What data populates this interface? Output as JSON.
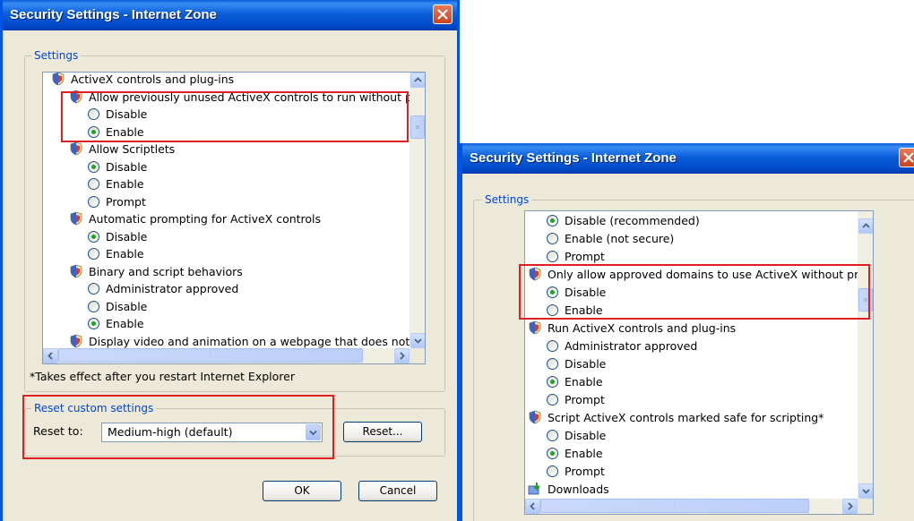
{
  "left_dialog": {
    "title": "Security Settings - Internet Zone",
    "settings_label": "Settings",
    "list": [
      {
        "kind": "header",
        "text": "ActiveX controls and plug-ins"
      },
      {
        "kind": "header",
        "text": "Allow previously unused ActiveX controls to run without prom"
      },
      {
        "kind": "option",
        "text": "Disable",
        "checked": false
      },
      {
        "kind": "option",
        "text": "Enable",
        "checked": true
      },
      {
        "kind": "header",
        "text": "Allow Scriptlets"
      },
      {
        "kind": "option",
        "text": "Disable",
        "checked": true
      },
      {
        "kind": "option",
        "text": "Enable",
        "checked": false
      },
      {
        "kind": "option",
        "text": "Prompt",
        "checked": false
      },
      {
        "kind": "header",
        "text": "Automatic prompting for ActiveX controls"
      },
      {
        "kind": "option",
        "text": "Disable",
        "checked": true
      },
      {
        "kind": "option",
        "text": "Enable",
        "checked": false
      },
      {
        "kind": "header",
        "text": "Binary and script behaviors"
      },
      {
        "kind": "option",
        "text": "Administrator approved",
        "checked": false
      },
      {
        "kind": "option",
        "text": "Disable",
        "checked": false
      },
      {
        "kind": "option",
        "text": "Enable",
        "checked": true
      },
      {
        "kind": "header",
        "text": "Display video and animation on a webpage that does not use"
      }
    ],
    "restart_note": "*Takes effect after you restart Internet Explorer",
    "reset_group_label": "Reset custom settings",
    "reset_to_label": "Reset to:",
    "reset_to_value": "Medium-high (default)",
    "reset_button": "Reset...",
    "ok_button": "OK",
    "cancel_button": "Cancel"
  },
  "right_dialog": {
    "title": "Security Settings - Internet Zone",
    "settings_label": "Settings",
    "list": [
      {
        "kind": "option",
        "text": "Disable (recommended)",
        "checked": true
      },
      {
        "kind": "option",
        "text": "Enable (not secure)",
        "checked": false
      },
      {
        "kind": "option",
        "text": "Prompt",
        "checked": false
      },
      {
        "kind": "header",
        "text": "Only allow approved domains to use ActiveX without prompt"
      },
      {
        "kind": "option",
        "text": "Disable",
        "checked": true
      },
      {
        "kind": "option",
        "text": "Enable",
        "checked": false
      },
      {
        "kind": "header",
        "text": "Run ActiveX controls and plug-ins"
      },
      {
        "kind": "option",
        "text": "Administrator approved",
        "checked": false
      },
      {
        "kind": "option",
        "text": "Disable",
        "checked": false
      },
      {
        "kind": "option",
        "text": "Enable",
        "checked": true
      },
      {
        "kind": "option",
        "text": "Prompt",
        "checked": false
      },
      {
        "kind": "header",
        "text": "Script ActiveX controls marked safe for scripting*"
      },
      {
        "kind": "option",
        "text": "Disable",
        "checked": false
      },
      {
        "kind": "option",
        "text": "Enable",
        "checked": true
      },
      {
        "kind": "option",
        "text": "Prompt",
        "checked": false
      },
      {
        "kind": "header",
        "text": "Downloads",
        "icon": "downloads-icon"
      }
    ]
  },
  "colors": {
    "highlight_box": "#e02020",
    "title_bar": "#0a5fd8",
    "group_label": "#0046d5",
    "radio_dot": "#21a121"
  }
}
